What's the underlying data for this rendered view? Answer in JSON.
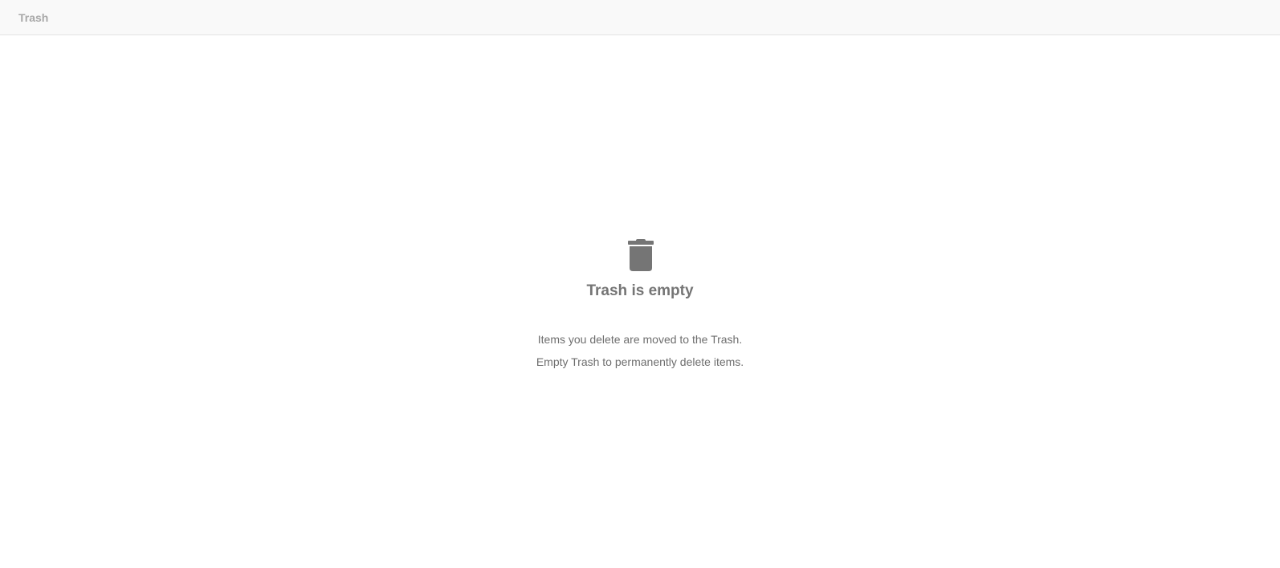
{
  "header": {
    "title": "Trash"
  },
  "empty_state": {
    "icon": "trash-icon",
    "title": "Trash is empty",
    "lines": [
      "Items you delete are moved to the Trash.",
      "Empty Trash to permanently delete items."
    ]
  },
  "colors": {
    "icon": "#757575",
    "title": "#757575",
    "body_text": "#6e6e6e",
    "header_bg": "#f9f9f9",
    "header_text": "#a8a8a8"
  }
}
